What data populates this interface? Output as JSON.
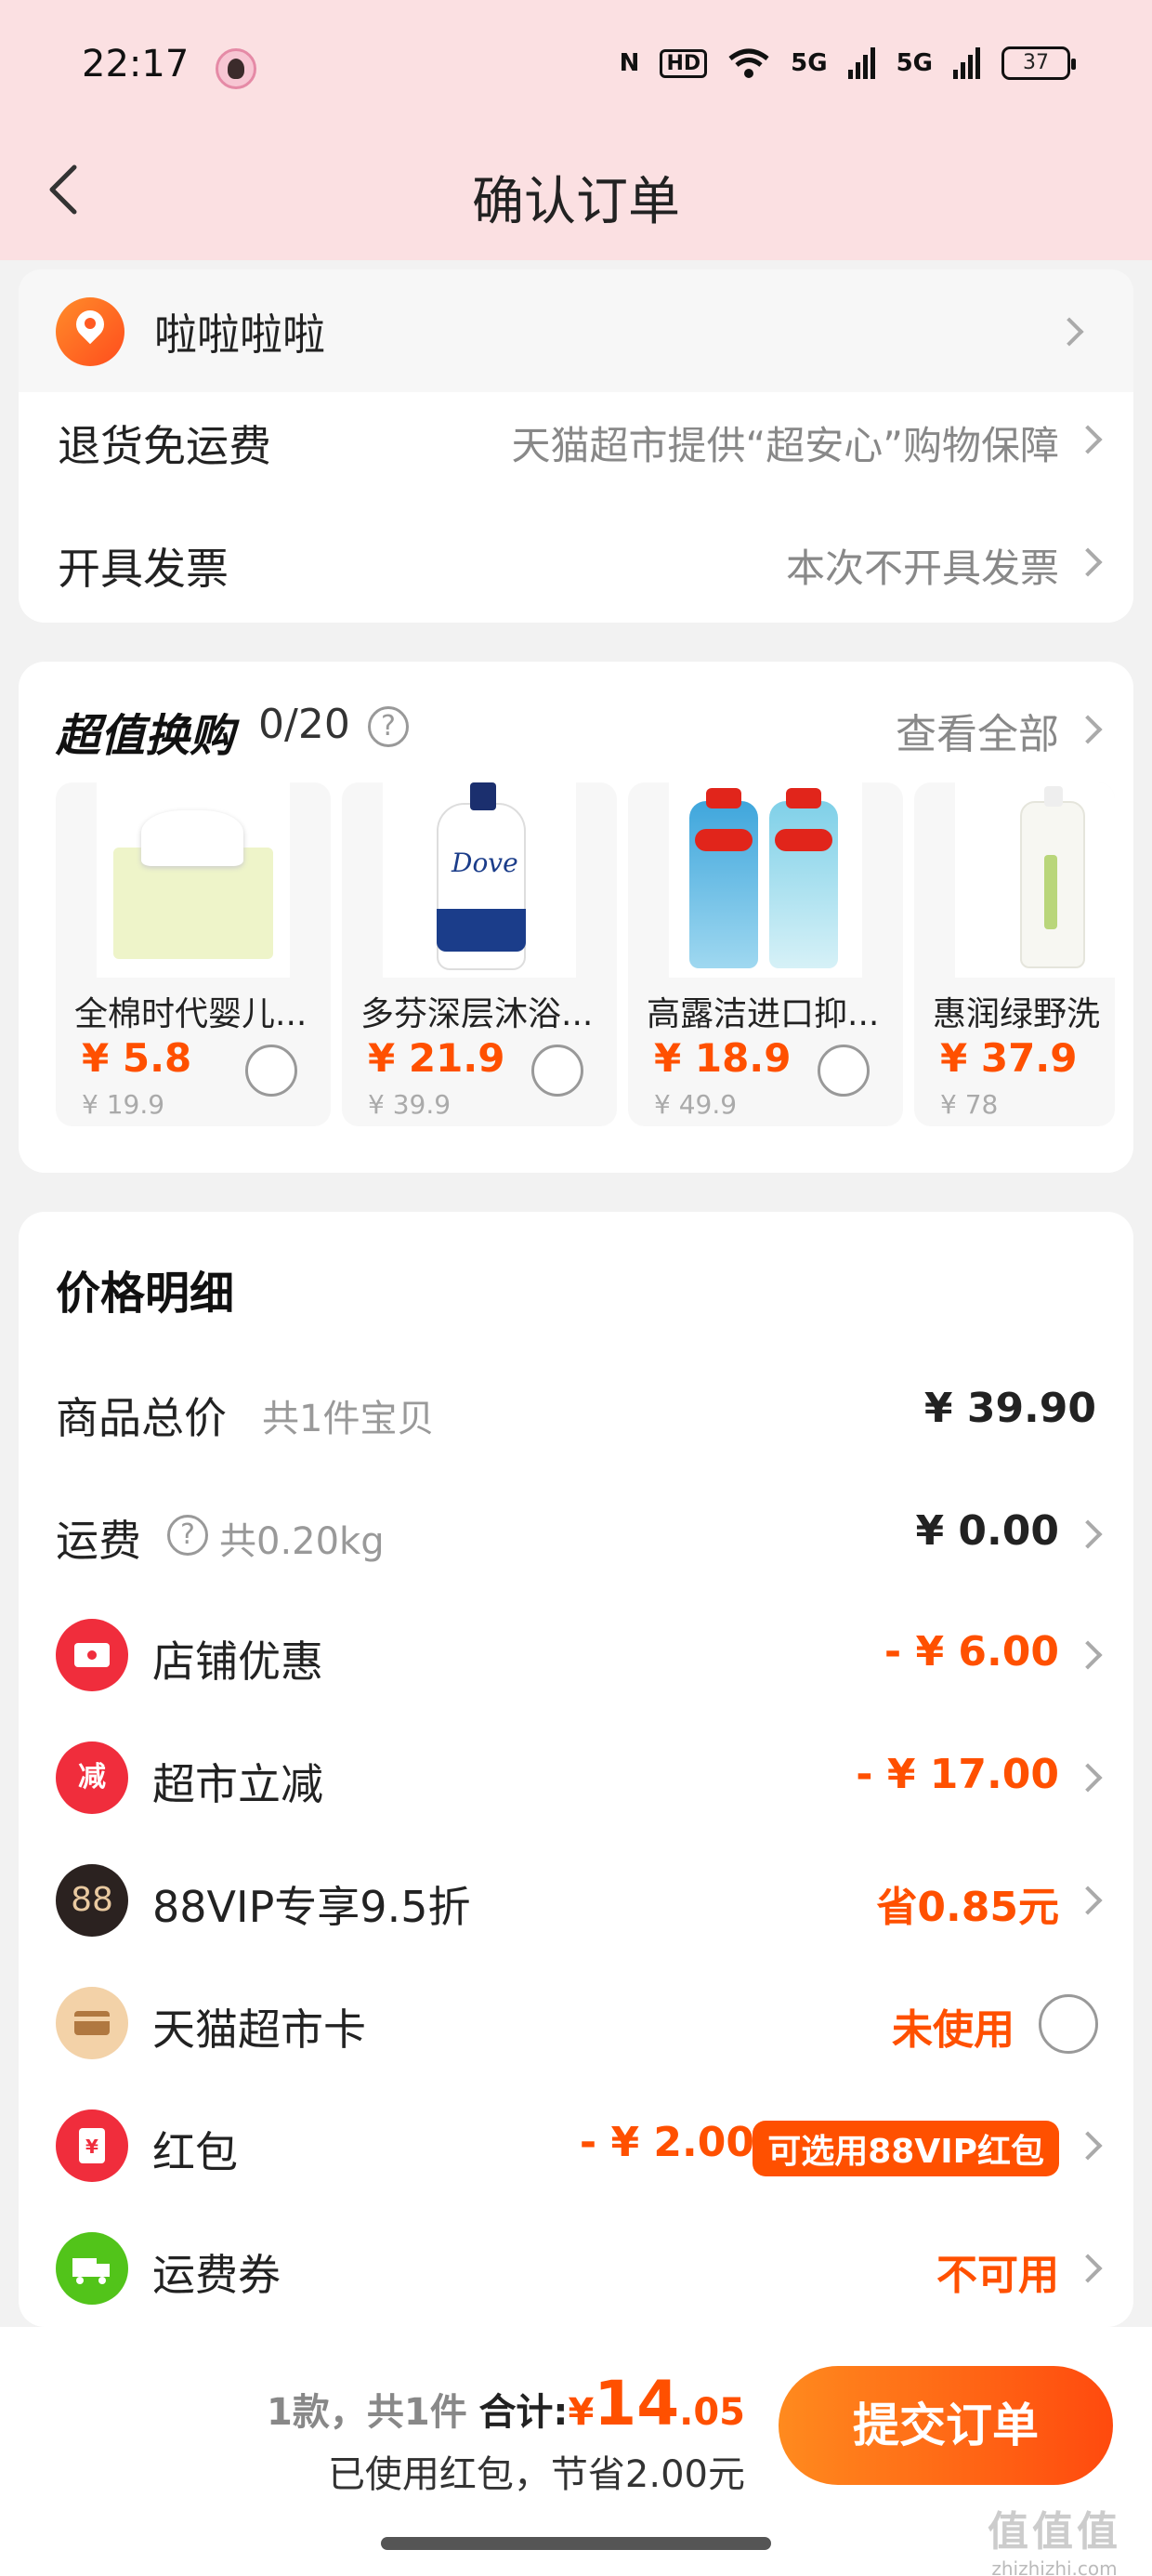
{
  "status_bar": {
    "time": "22:17",
    "nfc": "N",
    "hd": "HD",
    "signal1": "5G",
    "signal2": "5G",
    "battery": "37"
  },
  "nav": {
    "title": "确认订单",
    "back_icon": "back-arrow-icon"
  },
  "address": {
    "text": "啦啦啦啦",
    "icon": "location-pin-icon"
  },
  "info_rows": [
    {
      "label": "退货免运费",
      "value": "天猫超市提供“超安心”购物保障"
    },
    {
      "label": "开具发票",
      "value": "本次不开具发票"
    }
  ],
  "exchange": {
    "title": "超值换购",
    "count": "0/20",
    "view_all": "查看全部",
    "products": [
      {
        "name": "全棉时代婴儿...",
        "price": "¥ 5.8",
        "original": "¥ 19.9",
        "image": "tissue-box"
      },
      {
        "name": "多芬深层沐浴...",
        "price": "¥ 21.9",
        "original": "¥ 39.9",
        "image": "dove-body-wash"
      },
      {
        "name": "高露洁进口抑...",
        "price": "¥ 18.9",
        "original": "¥ 49.9",
        "image": "colgate-mouthwash"
      },
      {
        "name": "惠润绿野洗",
        "price": "¥ 37.9",
        "original": "¥ 78",
        "image": "super-mild-shampoo"
      }
    ]
  },
  "price_detail": {
    "title": "价格明细",
    "items_total": {
      "label": "商品总价",
      "sub": "共1件宝贝",
      "value": "¥ 39.90"
    },
    "shipping": {
      "label": "运费",
      "sub": "共0.20kg",
      "value": "¥ 0.00"
    },
    "store_discount": {
      "label": "店铺优惠",
      "value": "- ¥ 6.00",
      "icon": "coupon-icon",
      "color": "#f02d3c"
    },
    "market_reduce": {
      "label": "超市立减",
      "value": "- ¥ 17.00",
      "icon_text": "减",
      "color": "#f02d3c"
    },
    "vip": {
      "label": "88VIP专享9.5折",
      "value": "省0.85元",
      "icon_text": "88",
      "color": "#2b2220"
    },
    "tmall_card": {
      "label": "天猫超市卡",
      "value": "未使用",
      "icon": "card-icon",
      "color": "#f3d2a8"
    },
    "red_packet": {
      "label": "红包",
      "value": "- ¥ 2.00",
      "badge": "可选用88VIP红包",
      "icon_text": "¥",
      "color": "#f02d3c"
    },
    "shipping_coupon": {
      "label": "运费券",
      "value": "不可用",
      "icon": "truck-icon",
      "color": "#52c41a"
    }
  },
  "bottom": {
    "count": "1款，共1件",
    "total_label": "合计:",
    "total_symbol": "¥",
    "total_int": "14",
    "total_dec": ".05",
    "saved": "已使用红包，节省2.00元",
    "submit": "提交订单"
  },
  "watermark": {
    "logo": "值值值",
    "url": "zhizhizhi.com"
  },
  "colors": {
    "accent": "#ff5000",
    "header_bg": "#fbe0e2"
  }
}
